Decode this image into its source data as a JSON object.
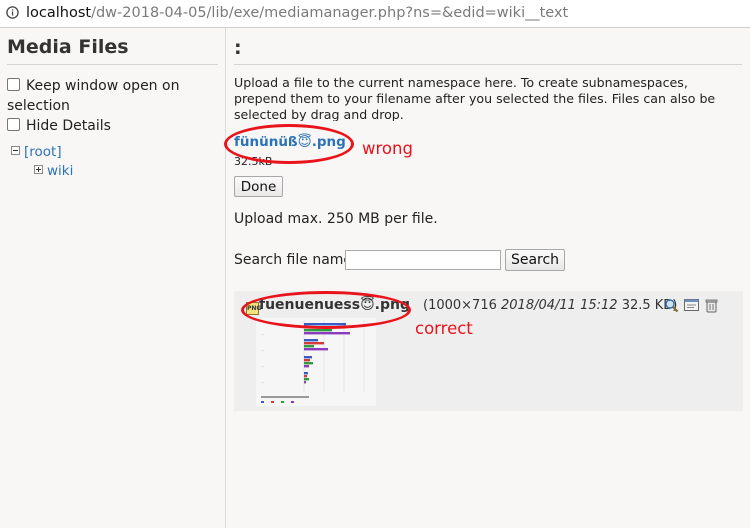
{
  "browser": {
    "url_host": "localhost",
    "url_path": "/dw-2018-04-05/lib/exe/mediamanager.php?ns=&edid=wiki__text"
  },
  "sidebar": {
    "title": "Media Files",
    "options": [
      {
        "label": "Keep window open on selection",
        "checked": false
      },
      {
        "label": "Hide Details",
        "checked": false
      }
    ],
    "tree": {
      "root": "[root]",
      "children": [
        "wiki"
      ]
    }
  },
  "main": {
    "namespace_title": ":",
    "intro": "Upload a file to the current namespace here. To create subnamespaces, prepend them to your filename after you selected the files. Files can also be selected by drag and drop.",
    "uploaded": {
      "filename": "fününüß😇.png",
      "size": "32.5kB"
    },
    "done_label": "Done",
    "max_upload": "Upload max. 250 MB per file.",
    "search": {
      "label": "Search file name:",
      "value": "",
      "button": "Search"
    },
    "result": {
      "icon_label": "PNG",
      "filename": "fuenuenuess😇.png",
      "dims_prefix": "(1000×716",
      "date": "2018/04/11 15:12",
      "size_suffix": "32.5 KB)",
      "actions": [
        "magnifier-icon",
        "insert-link-icon",
        "delete-icon"
      ],
      "thumbnail_chart": {
        "type": "bar",
        "series_colors": [
          "#3a5bc7",
          "#d43b3b",
          "#2e9c3e",
          "#8b3bbf"
        ]
      }
    }
  },
  "annotations": {
    "wrong": "wrong",
    "correct": "correct",
    "color": "#e8131b"
  }
}
